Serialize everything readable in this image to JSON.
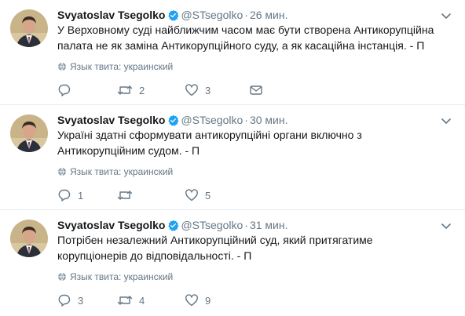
{
  "colors": {
    "accent": "#1da1f2",
    "muted": "#657786",
    "text": "#14171a",
    "divider": "#e6ecf0"
  },
  "icons": {
    "verified": "verified-badge-icon",
    "caret": "chevron-down-icon",
    "language": "globe-icon",
    "reply": "reply-icon",
    "retweet": "retweet-icon",
    "like": "heart-icon",
    "dm": "envelope-icon"
  },
  "tweets": [
    {
      "name": "Svyatoslav Tsegolko",
      "handle": "@STsegolko",
      "separator": "·",
      "time": "26 мин.",
      "text": "У Верховному суді найближчим часом має бути створена Антикорупційна\nпалата не як заміна Антикорупційного суду, а як касаційна інстанція. - П",
      "language": "Язык твита: украинский",
      "replies": "",
      "retweets": "2",
      "likes": "3"
    },
    {
      "name": "Svyatoslav Tsegolko",
      "handle": "@STsegolko",
      "separator": "·",
      "time": "30 мин.",
      "text": "Україні здатні сформувати антикорупційні органи включно з\nАнтикорупційним судом.  - П",
      "language": "Язык твита: украинский",
      "replies": "1",
      "retweets": "",
      "likes": "5"
    },
    {
      "name": "Svyatoslav Tsegolko",
      "handle": "@STsegolko",
      "separator": "·",
      "time": "31 мин.",
      "text": "Потрібен незалежний Антикорупційний суд, який притягатиме\nкорупціонерів до відповідальності. - П",
      "language": "Язык твита: украинский",
      "replies": "3",
      "retweets": "4",
      "likes": "9"
    }
  ]
}
